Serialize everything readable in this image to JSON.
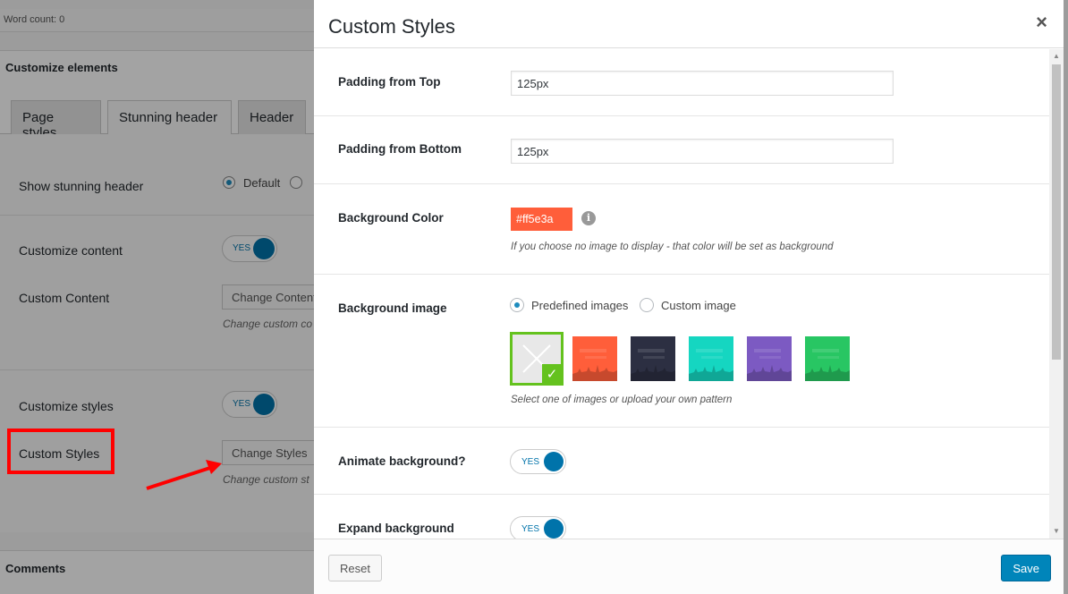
{
  "background": {
    "word_count": "Word count: 0",
    "panel_title": "Customize elements",
    "tabs": [
      "Page styles",
      "Stunning header",
      "Header"
    ],
    "show_stunning_header_label": "Show stunning header",
    "show_stunning_header_option": "Default",
    "customize_content_label": "Customize content",
    "customize_content_toggle": "YES",
    "custom_content_label": "Custom Content",
    "change_content_button": "Change Content",
    "change_content_help": "Change custom co",
    "customize_styles_label": "Customize styles",
    "customize_styles_toggle": "YES",
    "custom_styles_label": "Custom Styles",
    "change_styles_button": "Change Styles",
    "change_styles_help": "Change custom st",
    "comments_title": "Comments"
  },
  "modal": {
    "title": "Custom Styles",
    "close_icon": "×",
    "padding_top_label": "Padding from Top",
    "padding_top_value": "125px",
    "padding_bottom_label": "Padding from Bottom",
    "padding_bottom_value": "125px",
    "bg_color_label": "Background Color",
    "bg_color_value": "#ff5e3a",
    "bg_color_info_icon": "i",
    "bg_color_hint": "If you choose no image to display - that color will be set as background",
    "bg_image_label": "Background image",
    "bg_image_options": [
      "Predefined images",
      "Custom image"
    ],
    "bg_image_selected": "Predefined images",
    "bg_image_thumbs": [
      {
        "name": "none",
        "color": "#e8e8e8"
      },
      {
        "name": "orange",
        "color": "#ff5e3a"
      },
      {
        "name": "dark",
        "color": "#2c2f42"
      },
      {
        "name": "teal",
        "color": "#15d6c1"
      },
      {
        "name": "purple",
        "color": "#7c5ac2"
      },
      {
        "name": "green",
        "color": "#28c663"
      }
    ],
    "bg_image_hint": "Select one of images or upload your own pattern",
    "animate_label": "Animate background?",
    "animate_toggle": "YES",
    "expand_label": "Expand background",
    "expand_toggle": "YES",
    "reset_button": "Reset",
    "save_button": "Save"
  },
  "colors": {
    "accent": "#0073aa",
    "save_button": "#0085ba",
    "selected_border": "#64c21e",
    "highlight_box": "#ff0000"
  }
}
